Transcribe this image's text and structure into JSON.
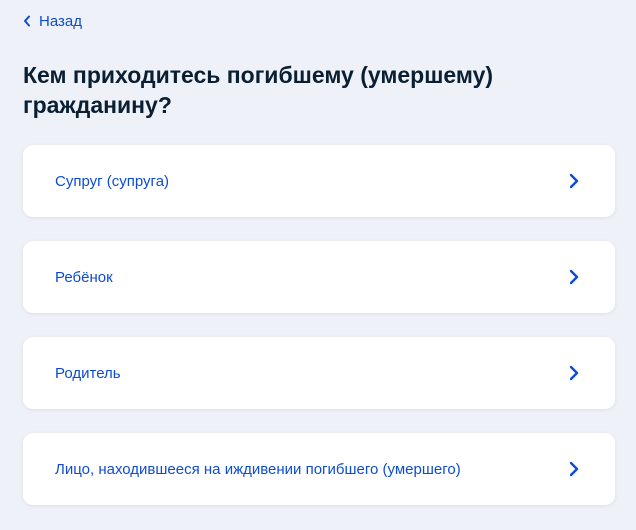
{
  "header": {
    "back_label": "Назад",
    "back_icon": "chevron-left-icon"
  },
  "question": {
    "title": "Кем приходитесь погибшему (умершему) гражданину?"
  },
  "options": [
    {
      "label": "Супруг (супруга)",
      "icon": "chevron-right-icon"
    },
    {
      "label": "Ребёнок",
      "icon": "chevron-right-icon"
    },
    {
      "label": "Родитель",
      "icon": "chevron-right-icon"
    },
    {
      "label": "Лицо, находившееся на иждивении погибшего (умершего)",
      "icon": "chevron-right-icon"
    }
  ],
  "colors": {
    "accent": "#0d4cd3",
    "background": "#eef2f8",
    "card": "#ffffff",
    "title": "#0b1f33"
  }
}
